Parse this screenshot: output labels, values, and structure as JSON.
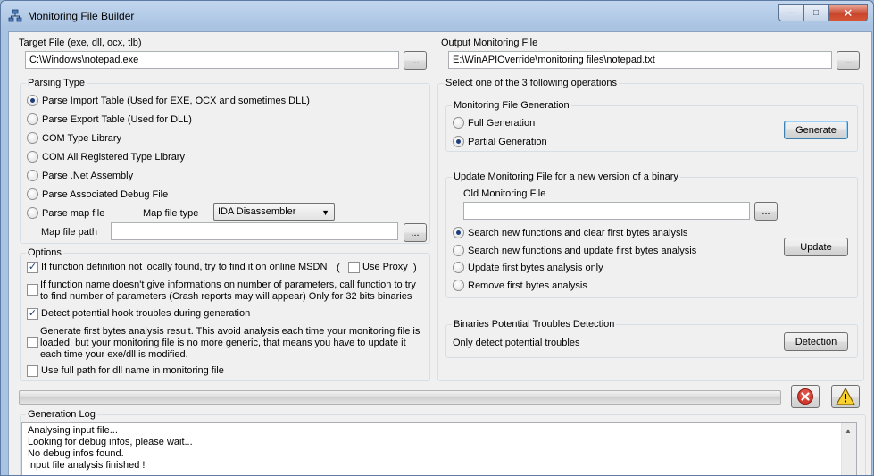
{
  "window": {
    "title": "Monitoring File Builder",
    "caption_buttons": {
      "minimize": "—",
      "maximize": "□",
      "close": "✕"
    }
  },
  "target": {
    "label": "Target File (exe, dll, ocx, tlb)",
    "value": "C:\\Windows\\notepad.exe",
    "browse_label": "..."
  },
  "output": {
    "label": "Output Monitoring File",
    "value": "E:\\WinAPIOverride\\monitoring files\\notepad.txt",
    "browse_label": "..."
  },
  "parsing": {
    "title": "Parsing Type",
    "options": [
      {
        "label": "Parse Import Table (Used for EXE, OCX and sometimes DLL)",
        "selected": true
      },
      {
        "label": "Parse Export Table (Used for DLL)",
        "selected": false
      },
      {
        "label": "COM Type Library",
        "selected": false
      },
      {
        "label": "COM All Registered Type Library",
        "selected": false
      },
      {
        "label": "Parse .Net Assembly",
        "selected": false
      },
      {
        "label": "Parse Associated Debug File",
        "selected": false
      },
      {
        "label": "Parse map file",
        "selected": false
      }
    ],
    "map_file_type_label": "Map file type",
    "map_file_type_value": "IDA Disassembler",
    "map_file_path_label": "Map file path",
    "map_file_path_value": "",
    "browse_label": "..."
  },
  "options": {
    "title": "Options",
    "online_msdn": {
      "label": "If function definition not locally found, try to find it on online MSDN",
      "checked": true
    },
    "paren_open": "(",
    "paren_close": ")",
    "use_proxy": {
      "label": "Use Proxy",
      "checked": false
    },
    "call_function": {
      "line1": "If function name doesn't give informations on number of parameters, call function to try",
      "line2": "to find number of parameters (Crash reports may will appear) Only for 32 bits binaries",
      "checked": false
    },
    "hook_troubles": {
      "label": "Detect potential hook troubles during generation",
      "checked": true
    },
    "first_bytes": {
      "line1": "Generate first bytes analysis result. This avoid analysis each time your monitoring file is",
      "line2": "loaded, but your monitoring file is no more generic, that means you have to update it",
      "line3": "each time your exe/dll is modified.",
      "checked": false
    },
    "full_path": {
      "label": "Use full path for dll name in monitoring file",
      "checked": false
    }
  },
  "operations": {
    "title": "Select one of the 3 following operations",
    "generation": {
      "title": "Monitoring File Generation",
      "full": {
        "label": "Full Generation",
        "selected": false
      },
      "partial": {
        "label": "Partial Generation",
        "selected": true
      },
      "button": "Generate"
    },
    "update": {
      "title": "Update Monitoring File for a new version of a binary",
      "old_file_label": "Old Monitoring File",
      "old_file_value": "",
      "browse_label": "...",
      "options": [
        {
          "label": "Search new functions and clear first bytes analysis",
          "selected": true
        },
        {
          "label": "Search new functions and update first bytes analysis",
          "selected": false
        },
        {
          "label": "Update first bytes analysis only",
          "selected": false
        },
        {
          "label": "Remove first bytes analysis",
          "selected": false
        }
      ],
      "button": "Update"
    },
    "detection": {
      "title": "Binaries Potential Troubles Detection",
      "text": "Only detect potential troubles",
      "button": "Detection"
    }
  },
  "progress": {
    "value": 0
  },
  "log": {
    "title": "Generation Log",
    "lines": [
      "Analysing input file...",
      "Looking for debug infos, please wait...",
      "No debug infos found.",
      "Input file analysis finished !"
    ]
  },
  "colors": {
    "title_bar": "#a9c3e2",
    "client": "#f0f0f0",
    "close_button": "#c8452c",
    "accent": "#3c7fb1"
  }
}
